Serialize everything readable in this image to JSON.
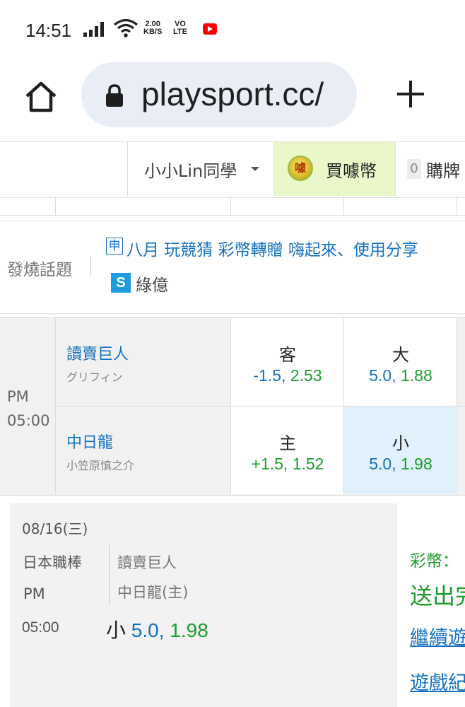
{
  "status_bar": {
    "time": "14:51",
    "net_rate_value": "2.00",
    "net_rate_unit": "KB/S",
    "volte_top": "VO",
    "volte_bottom": "LTE",
    "icons": [
      "signal-icon",
      "wifi-icon",
      "youtube-icon"
    ]
  },
  "browser": {
    "url": "playsport.cc/",
    "icons": [
      "home-icon",
      "lock-icon",
      "plus-icon"
    ]
  },
  "site_nav": {
    "user_menu": "小小Lin同學",
    "buy_coins": "買噱幣",
    "coin_glyph": "噱",
    "cart_count": "0",
    "cart_label": "購牌"
  },
  "hot_topics": {
    "label": "發燒話題",
    "badge": "申",
    "topic": "八月 玩競猜 彩幣轉贈 嗨起來、使用分享",
    "user_badge": "S",
    "user": "綠億"
  },
  "game": {
    "time_period": "PM",
    "time_value": "05:00",
    "teams": [
      {
        "name": "讀賣巨人",
        "pitcher": "グリフィン",
        "spread_label": "客",
        "spread_line": "-1.5,",
        "spread_odds": "2.53",
        "total_label": "大",
        "total_line": "5.0,",
        "total_odds": "1.88"
      },
      {
        "name": "中日龍",
        "pitcher": "小笠原慎之介",
        "spread_label": "主",
        "spread_line": "+1.5,",
        "spread_odds": "1.52",
        "total_label": "小",
        "total_line": "5.0,",
        "total_odds": "1.98"
      }
    ]
  },
  "bet_card": {
    "date": "08/16(三)",
    "league": "日本職棒",
    "away": "讀賣巨人",
    "home": "中日龍(主)",
    "period": "PM",
    "time": "05:00",
    "pick_label": "小",
    "pick_line": "5.0,",
    "pick_odds": "1.98"
  },
  "right_panel": {
    "coins_label": "彩幣：",
    "sent": "送出完",
    "continue_link": "繼續遊",
    "record_link": "遊戲紀"
  },
  "colors": {
    "link_blue": "#1572c4",
    "odds_green": "#1a9d2a",
    "buy_bg": "#eaf7c9",
    "selected_cell": "#e1f1fb",
    "url_pill": "#e9eef6"
  }
}
